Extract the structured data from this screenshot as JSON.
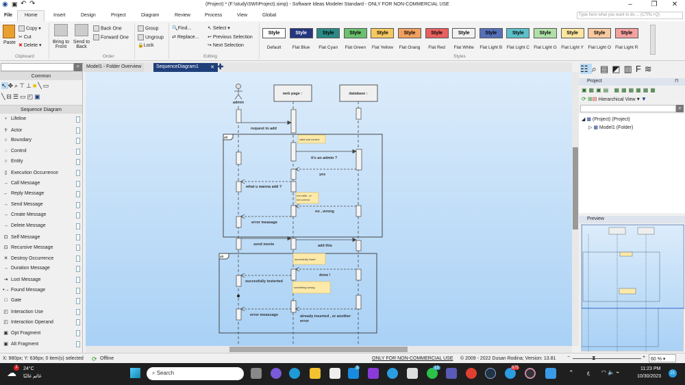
{
  "window": {
    "title": "(Project) *  (F:\\study\\SWI\\Project).simp) - Software Ideas Modeler Standard - ONLY FOR NON-COMMERCIAL USE",
    "ask_placeholder": "Type here what you want to do ...  (CTRL+Q)"
  },
  "menu_tabs": [
    "File",
    "Home",
    "Insert",
    "Design",
    "Project",
    "Diagram",
    "Review",
    "Process",
    "View",
    "Global"
  ],
  "ribbon": {
    "clipboard": {
      "paste": "Paste",
      "copy": "Copy",
      "cut": "Cut",
      "delete": "Delete",
      "group": "Clipboard"
    },
    "order": {
      "bring_front": "Bring to Front",
      "send_back": "Send to Back",
      "back_one": "Back One",
      "forward_one": "Forward One",
      "group_btn": "Group",
      "ungroup": "Ungroup",
      "lock": "Lock",
      "group": "Order"
    },
    "editing": {
      "find": "Find...",
      "replace": "Replace...",
      "select": "Select",
      "prev_sel": "Previous Selection",
      "next_sel": "Next Selection",
      "group": "Editing"
    },
    "styles": {
      "group": "Styles",
      "button_label": "Style",
      "items": [
        {
          "name": "Default",
          "color": "#ffffff",
          "fg": "#000"
        },
        {
          "name": "Flat Blue",
          "color": "#24367e",
          "fg": "#fff"
        },
        {
          "name": "Flat Cyan",
          "color": "#2a8a86",
          "fg": "#000"
        },
        {
          "name": "Flat Green",
          "color": "#6cc070",
          "fg": "#000"
        },
        {
          "name": "Flat Yellow",
          "color": "#f5c860",
          "fg": "#000"
        },
        {
          "name": "Flat Orang",
          "color": "#f0a060",
          "fg": "#000"
        },
        {
          "name": "Flat Red",
          "color": "#e86060",
          "fg": "#000"
        },
        {
          "name": "Flat White",
          "color": "#f2f2f2",
          "fg": "#000"
        },
        {
          "name": "Flat  Light B",
          "color": "#5570b8",
          "fg": "#000"
        },
        {
          "name": "Flat  Light C",
          "color": "#5cc0c8",
          "fg": "#000"
        },
        {
          "name": "Flat  Light G",
          "color": "#b0e0a8",
          "fg": "#000"
        },
        {
          "name": "Flat  Light Y",
          "color": "#fbe6a0",
          "fg": "#000"
        },
        {
          "name": "Flat  Light O",
          "color": "#f8c8a0",
          "fg": "#000"
        },
        {
          "name": "Flat  Light R",
          "color": "#f4a0a0",
          "fg": "#000"
        }
      ]
    }
  },
  "palette": {
    "common": "Common",
    "sequence": "Sequence Diagram",
    "items": [
      "Lifeline",
      "Actor",
      "Boundary",
      "Control",
      "Entity",
      "Execution Occurrence",
      "Call Message",
      "Reply Message",
      "Send Message",
      "Create Message",
      "Delete Message",
      "Self Message",
      "Recursive Message",
      "Destroy Occurrence",
      "Duration Message",
      "Lost Message",
      "Found Message",
      "Gate",
      "Interaction Use",
      "Interaction Operand",
      "Opt Fragment",
      "Alt Fragment"
    ]
  },
  "doc_tabs": [
    "Model1 - Folder Overview",
    "SequenceDiagram1"
  ],
  "diagram": {
    "lifelines": [
      "admin",
      "web page :",
      "database :"
    ],
    "frames": [
      "alt",
      "alt"
    ],
    "notes": [
      "valid and correct",
      "not valid , or",
      "not correct",
      "succesfully insert .",
      "something wrong"
    ],
    "messages": [
      "request to add",
      "it's an admin ?",
      "yes",
      "what u wanna add ?",
      "no , wrong",
      "error measage",
      "send movie",
      "add this",
      "done !",
      "succesfully insterted",
      "error meassage",
      "already inserted , or another",
      "error"
    ]
  },
  "project_panel": {
    "title": "Project",
    "view": "Hierarchical View",
    "tree": [
      "(Project) (Project)",
      "Model1 (Folder)"
    ]
  },
  "preview_panel": {
    "title": "Preview"
  },
  "status": {
    "coords": "X: 980px; Y: 636px; 0 item(s) selected",
    "offline": "Offline",
    "license": "ONLY FOR NON-COMMERCIAL USE",
    "copyright": "© 2009 - 2022 Dusan Rodina; Version: 13.81",
    "zoom": "60 %"
  },
  "taskbar": {
    "temp": "24°C",
    "weather": "غائم غالبًا",
    "weather_badge": "1",
    "search": "Search",
    "mail_badge": "3",
    "whatsapp_badge": "13",
    "telegram_badge": "875",
    "lang": "ع",
    "time": "11:23 PM",
    "date": "10/30/2023",
    "notif": "21"
  }
}
